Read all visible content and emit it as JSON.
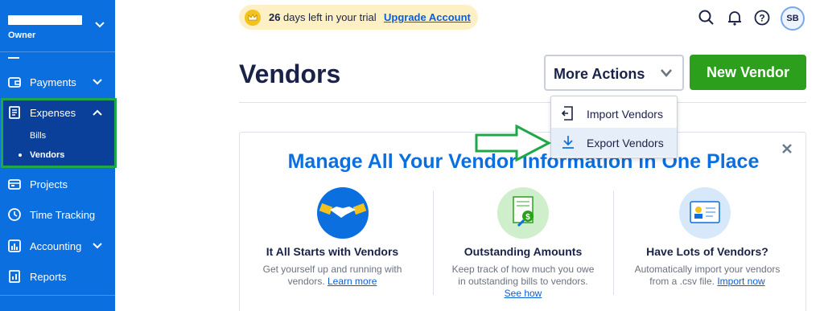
{
  "sidebar": {
    "account_role": "Owner",
    "items": [
      {
        "label": "Payments",
        "icon": "wallet-icon"
      },
      {
        "label": "Expenses",
        "icon": "receipt-icon"
      },
      {
        "label": "Projects",
        "icon": "folder-icon"
      },
      {
        "label": "Time Tracking",
        "icon": "clock-icon"
      },
      {
        "label": "Accounting",
        "icon": "bar-chart-icon"
      },
      {
        "label": "Reports",
        "icon": "report-icon"
      }
    ],
    "expenses_sub": [
      {
        "label": "Bills",
        "active": false
      },
      {
        "label": "Vendors",
        "active": true
      }
    ]
  },
  "topbar": {
    "trial_days": "26",
    "trial_text": "days left in your trial",
    "upgrade_label": "Upgrade Account",
    "avatar_initials": "SB"
  },
  "header": {
    "title": "Vendors",
    "more_actions_label": "More Actions",
    "new_vendor_label": "New Vendor"
  },
  "dropdown": {
    "items": [
      {
        "label": "Import Vendors",
        "icon": "import-icon"
      },
      {
        "label": "Export Vendors",
        "icon": "download-icon"
      }
    ]
  },
  "promo": {
    "title": "Manage All Your Vendor Information in One Place",
    "features": [
      {
        "title": "It All Starts with Vendors",
        "desc1": "Get yourself up and running with",
        "desc2": "vendors.",
        "link": "Learn more",
        "icon": "handshake-icon"
      },
      {
        "title": "Outstanding Amounts",
        "desc1": "Keep track of how much you owe",
        "desc2": "in outstanding bills to vendors.",
        "link": "See how",
        "icon": "invoice-magnifier-icon"
      },
      {
        "title": "Have Lots of Vendors?",
        "desc1": "Automatically import your vendors",
        "desc2": "from a .csv file.",
        "link": "Import now",
        "icon": "contact-card-icon"
      }
    ]
  },
  "colors": {
    "sidebar": "#0b6fe0",
    "primary_green": "#2ca01c",
    "highlight_green": "#1ea84a",
    "accent_blue": "#0b6fe0"
  }
}
